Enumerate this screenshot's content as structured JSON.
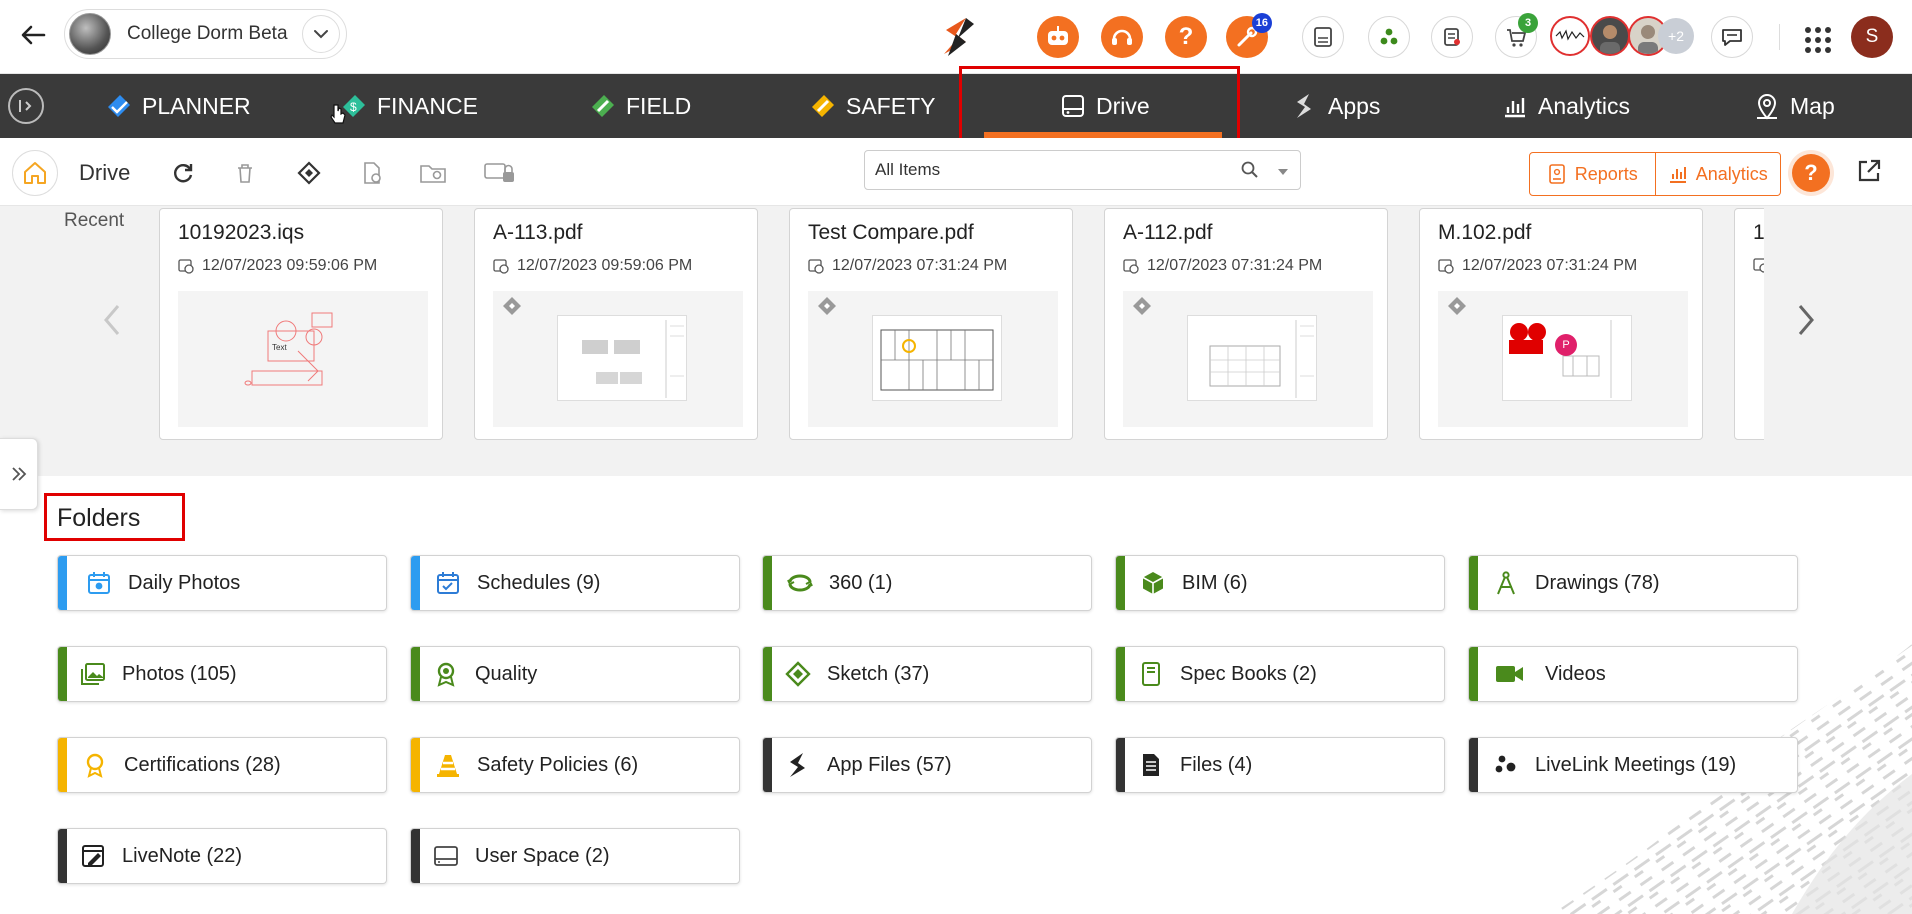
{
  "header": {
    "project_name": "College Dorm Beta",
    "notifications": {
      "updates_count": "16",
      "cart_count": "3",
      "more_members": "+2"
    },
    "user_initial": "S",
    "icons": [
      "back-arrow-icon",
      "brand-logo-icon",
      "ai-bot-icon",
      "support-headset-icon",
      "help-icon",
      "tools-icon",
      "inbox-icon",
      "network-icon",
      "documents-icon",
      "cart-icon",
      "chat-icon",
      "apps-grid-icon"
    ]
  },
  "nav": {
    "items": [
      {
        "label": "PLANNER",
        "icon": "planner-icon",
        "color": "#2d8cf0"
      },
      {
        "label": "FINANCE",
        "icon": "finance-icon",
        "color": "#2dbf9a"
      },
      {
        "label": "FIELD",
        "icon": "field-icon",
        "color": "#4caf50"
      },
      {
        "label": "SAFETY",
        "icon": "safety-icon",
        "color": "#f5b400"
      },
      {
        "label": "Drive",
        "icon": "drive-icon",
        "active": true
      },
      {
        "label": "Apps",
        "icon": "apps-icon"
      },
      {
        "label": "Analytics",
        "icon": "analytics-icon"
      },
      {
        "label": "Map",
        "icon": "map-pin-icon"
      }
    ]
  },
  "toolbar": {
    "title": "Drive",
    "search_value": "All Items",
    "reports_label": "Reports",
    "analytics_label": "Analytics",
    "help_label": "?"
  },
  "recent": {
    "label": "Recent",
    "cards": [
      {
        "name": "10192023.iqs",
        "date": "12/07/2023 09:59:06 PM",
        "thumb_text": "Text"
      },
      {
        "name": "A-113.pdf",
        "date": "12/07/2023 09:59:06 PM"
      },
      {
        "name": "Test Compare.pdf",
        "date": "12/07/2023 07:31:24 PM"
      },
      {
        "name": "A-112.pdf",
        "date": "12/07/2023 07:31:24 PM"
      },
      {
        "name": "M.102.pdf",
        "date": "12/07/2023 07:31:24 PM",
        "marker": "P"
      },
      {
        "name": "1",
        "date": ""
      }
    ]
  },
  "folders": {
    "title": "Folders",
    "items": [
      {
        "label": "Daily Photos",
        "icon": "calendar-camera-icon",
        "color": "#2d9cf0"
      },
      {
        "label": "Schedules (9)",
        "icon": "calendar-check-icon",
        "color": "#2d9cf0"
      },
      {
        "label": "360 (1)",
        "icon": "rotate-360-icon",
        "color": "#4a8a1c"
      },
      {
        "label": "BIM (6)",
        "icon": "cube-icon",
        "color": "#4a8a1c"
      },
      {
        "label": "Drawings (78)",
        "icon": "compass-icon",
        "color": "#4a8a1c"
      },
      {
        "label": "Photos (105)",
        "icon": "photos-icon",
        "color": "#4a8a1c"
      },
      {
        "label": "Quality",
        "icon": "quality-badge-icon",
        "color": "#4a8a1c"
      },
      {
        "label": "Sketch (37)",
        "icon": "sketch-icon",
        "color": "#4a8a1c"
      },
      {
        "label": "Spec Books (2)",
        "icon": "book-icon",
        "color": "#4a8a1c"
      },
      {
        "label": "Videos",
        "icon": "video-camera-icon",
        "color": "#4a8a1c"
      },
      {
        "label": "Certifications (28)",
        "icon": "certificate-icon",
        "color": "#f5b400"
      },
      {
        "label": "Safety Policies (6)",
        "icon": "traffic-cone-icon",
        "color": "#f5b400"
      },
      {
        "label": "App Files (57)",
        "icon": "app-files-icon",
        "color": "#333333"
      },
      {
        "label": "Files (4)",
        "icon": "file-icon",
        "color": "#333333"
      },
      {
        "label": "LiveLink Meetings (19)",
        "icon": "livelink-icon",
        "color": "#333333"
      },
      {
        "label": "LiveNote (22)",
        "icon": "livenote-icon",
        "color": "#333333"
      },
      {
        "label": "User Space (2)",
        "icon": "user-space-icon",
        "color": "#333333"
      }
    ]
  }
}
